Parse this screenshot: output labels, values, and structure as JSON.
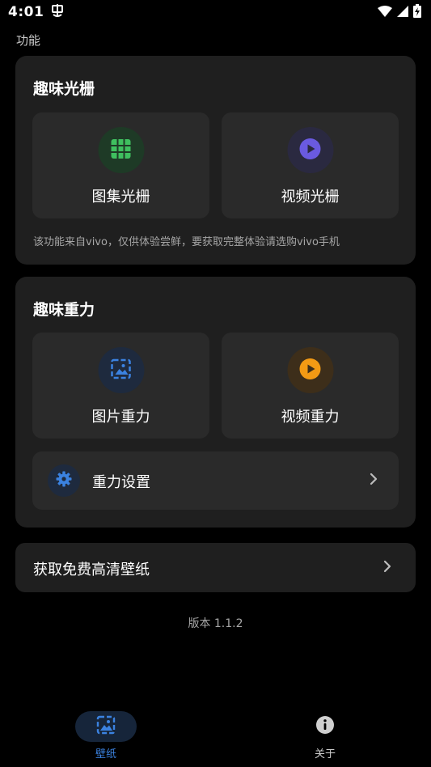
{
  "status_bar": {
    "time": "4:01"
  },
  "section_label": "功能",
  "grating_card": {
    "title": "趣味光栅",
    "tiles": [
      {
        "label": "图集光栅",
        "icon": "grid-icon",
        "color": "#3fbf5f",
        "bg": "#1e3a26"
      },
      {
        "label": "视频光栅",
        "icon": "play-icon",
        "color": "#6a5ae0",
        "bg": "#2a2940"
      }
    ],
    "note": "该功能来自vivo，仅供体验尝鲜，要获取完整体验请选购vivo手机"
  },
  "gravity_card": {
    "title": "趣味重力",
    "tiles": [
      {
        "label": "图片重力",
        "icon": "image-icon",
        "color": "#3b82e0",
        "bg": "#1e2a3e"
      },
      {
        "label": "视频重力",
        "icon": "play-icon",
        "color": "#f39a14",
        "bg": "#3d2e1a"
      }
    ],
    "settings_label": "重力设置"
  },
  "wallpaper_row": {
    "label": "获取免费高清壁纸"
  },
  "version": "版本 1.1.2",
  "bottom_nav": {
    "items": [
      {
        "label": "壁纸",
        "icon": "wallpaper-icon",
        "active": true
      },
      {
        "label": "关于",
        "icon": "info-icon",
        "active": false
      }
    ]
  },
  "colors": {
    "accent": "#3b82e0",
    "card_bg": "#1f1f1f",
    "tile_bg": "#2a2a2a"
  }
}
